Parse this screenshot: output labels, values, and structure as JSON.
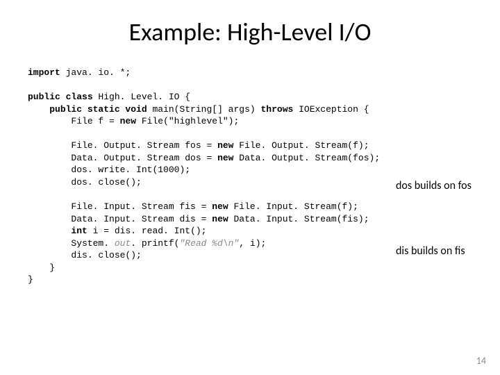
{
  "title": "Example: High-Level I/O",
  "code": {
    "l1a": "import",
    "l1b": " java. io. *;",
    "l2a": "public class ",
    "l2b": "High. Level. IO {",
    "l3a": "public static void ",
    "l3b": "main(String[] args) ",
    "l3c": "throws ",
    "l3d": "IOException {",
    "l4a": "File f = ",
    "l4b": "new ",
    "l4c": "File(\"highlevel\");",
    "l5a": "File. Output. Stream fos = ",
    "l5b": "new ",
    "l5c": "File. Output. Stream(f);",
    "l6a": "Data. Output. Stream dos = ",
    "l6b": "new ",
    "l6c": "Data. Output. Stream(fos);",
    "l7": "dos. write. Int(1000);",
    "l8": "dos. close();",
    "l9a": "File. Input. Stream fis = ",
    "l9b": "new ",
    "l9c": "File. Input. Stream(f);",
    "l10a": "Data. Input. Stream dis = ",
    "l10b": "new ",
    "l10c": "Data. Input. Stream(fis);",
    "l11a": "int ",
    "l11b": "i = dis. read. Int();",
    "l12a": "System. ",
    "l12b": "out",
    "l12c": ". printf(",
    "l12d": "\"Read %d\\n\"",
    "l12e": ", i);",
    "l13": "dis. close();",
    "l14": "}",
    "l15": "}"
  },
  "annotations": {
    "a1": "dos builds on fos",
    "a2": "dis builds on fis"
  },
  "page": "14"
}
